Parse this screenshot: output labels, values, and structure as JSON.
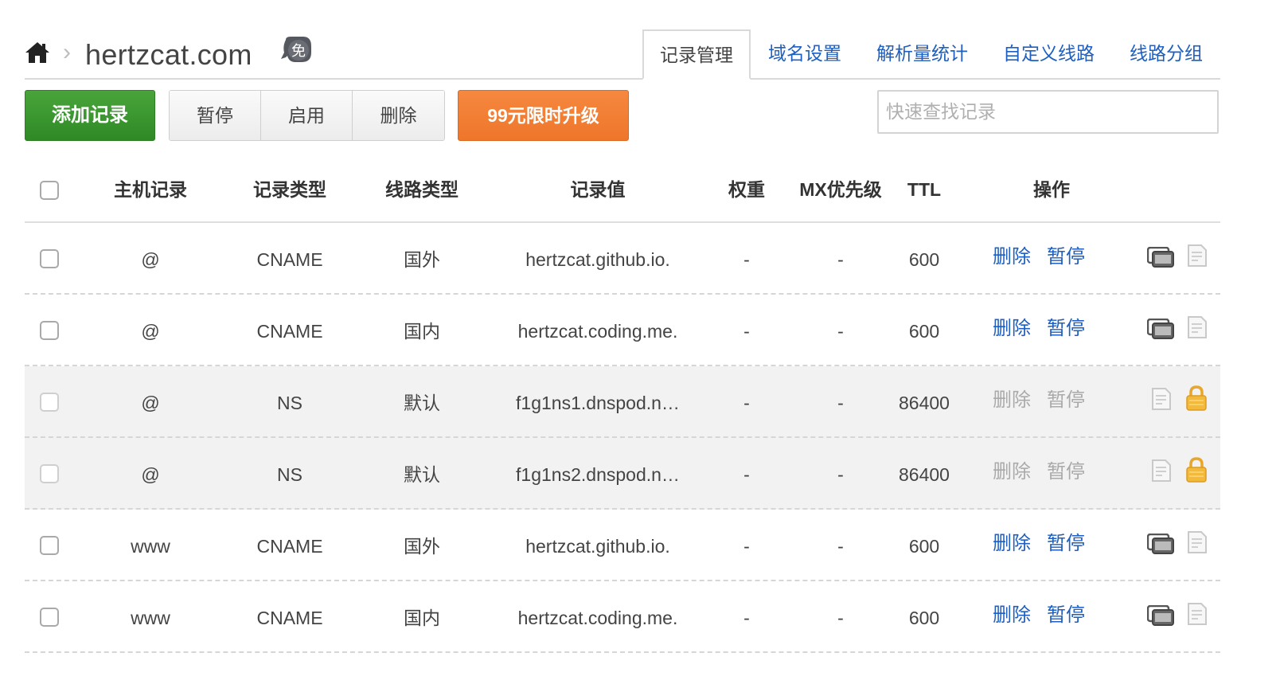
{
  "breadcrumb": {
    "home_icon": "home-icon",
    "separator": "›",
    "domain": "hertzcat.com",
    "badge_text": "免"
  },
  "tabs": [
    {
      "label": "记录管理",
      "active": true
    },
    {
      "label": "域名设置",
      "active": false
    },
    {
      "label": "解析量统计",
      "active": false
    },
    {
      "label": "自定义线路",
      "active": false
    },
    {
      "label": "线路分组",
      "active": false
    }
  ],
  "toolbar": {
    "add_label": "添加记录",
    "pause_label": "暂停",
    "enable_label": "启用",
    "delete_label": "删除",
    "upgrade_label": "99元限时升级",
    "search_placeholder": "快速查找记录",
    "colors": {
      "add": "#3a9630",
      "upgrade": "#f07d33",
      "link": "#1e5fbf"
    }
  },
  "table": {
    "headers": {
      "host": "主机记录",
      "type": "记录类型",
      "line": "线路类型",
      "value": "记录值",
      "weight": "权重",
      "mx": "MX优先级",
      "ttl": "TTL",
      "ops": "操作"
    },
    "rows": [
      {
        "host": "@",
        "type": "CNAME",
        "line": "国外",
        "value": "hertzcat.github.io.",
        "weight": "-",
        "mx": "-",
        "ttl": "600",
        "delete": "删除",
        "pause": "暂停",
        "system": false,
        "icons": [
          "remark-icon",
          "document-icon"
        ]
      },
      {
        "host": "@",
        "type": "CNAME",
        "line": "国内",
        "value": "hertzcat.coding.me.",
        "weight": "-",
        "mx": "-",
        "ttl": "600",
        "delete": "删除",
        "pause": "暂停",
        "system": false,
        "icons": [
          "remark-icon",
          "document-icon"
        ]
      },
      {
        "host": "@",
        "type": "NS",
        "line": "默认",
        "value": "f1g1ns1.dnspod.n…",
        "weight": "-",
        "mx": "-",
        "ttl": "86400",
        "delete": "删除",
        "pause": "暂停",
        "system": true,
        "icons": [
          "document-icon",
          "lock-icon"
        ]
      },
      {
        "host": "@",
        "type": "NS",
        "line": "默认",
        "value": "f1g1ns2.dnspod.n…",
        "weight": "-",
        "mx": "-",
        "ttl": "86400",
        "delete": "删除",
        "pause": "暂停",
        "system": true,
        "icons": [
          "document-icon",
          "lock-icon"
        ]
      },
      {
        "host": "www",
        "type": "CNAME",
        "line": "国外",
        "value": "hertzcat.github.io.",
        "weight": "-",
        "mx": "-",
        "ttl": "600",
        "delete": "删除",
        "pause": "暂停",
        "system": false,
        "icons": [
          "remark-icon",
          "document-icon"
        ]
      },
      {
        "host": "www",
        "type": "CNAME",
        "line": "国内",
        "value": "hertzcat.coding.me.",
        "weight": "-",
        "mx": "-",
        "ttl": "600",
        "delete": "删除",
        "pause": "暂停",
        "system": false,
        "icons": [
          "remark-icon",
          "document-icon"
        ]
      }
    ]
  }
}
